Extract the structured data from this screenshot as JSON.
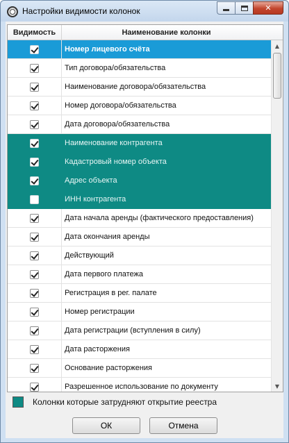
{
  "window": {
    "title": "Настройки видимости колонок"
  },
  "header": {
    "visibility": "Видимость",
    "name": "Наименование колонки"
  },
  "rows": [
    {
      "label": "Номер лицевого счёта",
      "checked": true,
      "state": "selected"
    },
    {
      "label": "Тип договора/обязательства",
      "checked": true,
      "state": "normal"
    },
    {
      "label": "Наименование договора/обязательства",
      "checked": true,
      "state": "normal"
    },
    {
      "label": "Номер договора/обязательства",
      "checked": true,
      "state": "normal"
    },
    {
      "label": "Дата договора/обязательства",
      "checked": true,
      "state": "normal"
    },
    {
      "label": "Наименование контрагента",
      "checked": true,
      "state": "teal"
    },
    {
      "label": "Кадастровый номер объекта",
      "checked": true,
      "state": "teal"
    },
    {
      "label": "Адрес объекта",
      "checked": true,
      "state": "teal"
    },
    {
      "label": "ИНН контрагента",
      "checked": false,
      "state": "teal"
    },
    {
      "label": "Дата начала аренды (фактического предоставления)",
      "checked": true,
      "state": "normal"
    },
    {
      "label": "Дата окончания аренды",
      "checked": true,
      "state": "normal"
    },
    {
      "label": "Действующий",
      "checked": true,
      "state": "normal"
    },
    {
      "label": "Дата первого платежа",
      "checked": true,
      "state": "normal"
    },
    {
      "label": "Регистрация в рег. палате",
      "checked": true,
      "state": "normal"
    },
    {
      "label": "Номер регистрации",
      "checked": true,
      "state": "normal"
    },
    {
      "label": "Дата регистрации (вступления в силу)",
      "checked": true,
      "state": "normal"
    },
    {
      "label": "Дата расторжения",
      "checked": true,
      "state": "normal"
    },
    {
      "label": "Основание расторжения",
      "checked": true,
      "state": "normal"
    },
    {
      "label": "Разрешенное использование по документу",
      "checked": true,
      "state": "normal"
    }
  ],
  "legend": {
    "text": "Колонки которые затрудняют открытие реестра",
    "color": "#0e8a84"
  },
  "buttons": {
    "ok": "ОК",
    "cancel": "Отмена"
  },
  "colors": {
    "selected": "#1a9bd7",
    "highlight": "#0e8a84"
  }
}
